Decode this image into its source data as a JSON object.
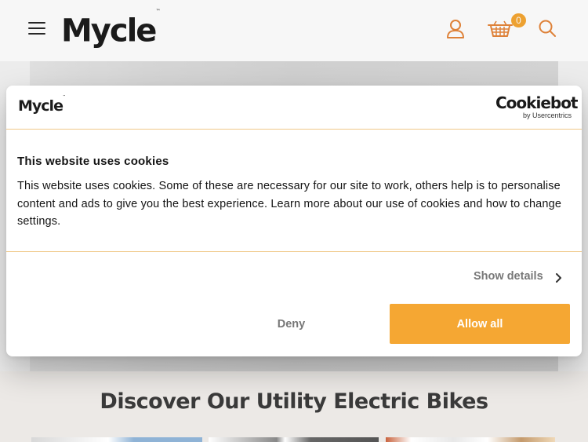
{
  "header": {
    "logo_text": "Mycle",
    "logo_tm": "™",
    "cart_count": "0",
    "icons": [
      "menu-icon",
      "user-icon",
      "basket-icon",
      "search-icon"
    ],
    "accent_color": "#f5a733"
  },
  "cookie_dialog": {
    "logo_text": "Mycle",
    "logo_tm": "™",
    "provider_name": "Cookiebot",
    "provider_by": "by Usercentrics",
    "title": "This website uses cookies",
    "body": "This website uses cookies. Some of these are necessary for our site to work, others help is to personalise content and ads to give you the best experience. Learn more about our use of cookies and how to change settings.",
    "show_details_label": "Show details",
    "deny_label": "Deny",
    "allow_all_label": "Allow all"
  },
  "section": {
    "title": "Discover Our Utility Electric Bikes"
  }
}
